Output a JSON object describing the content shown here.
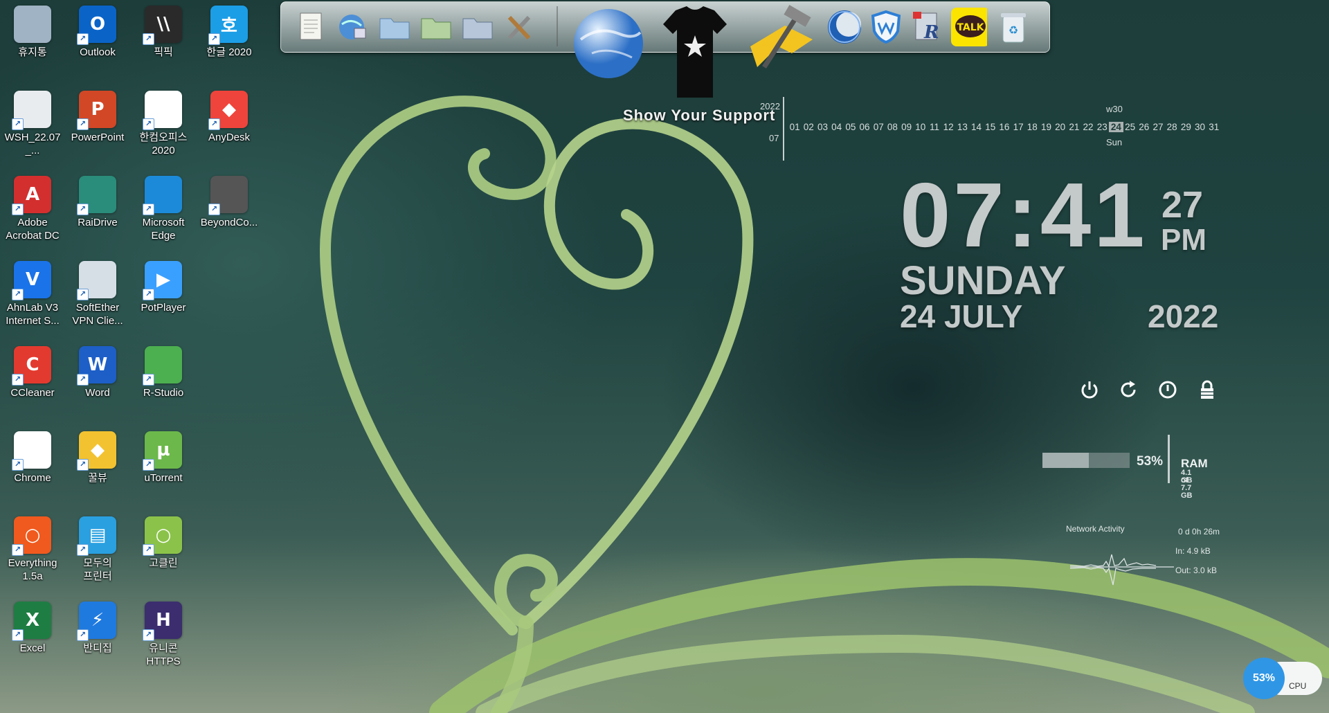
{
  "desktop": {
    "icons": [
      {
        "label": "휴지통",
        "icon": "recycle-bin-icon",
        "color": "#9fb3c4"
      },
      {
        "label": "Outlook",
        "icon": "outlook-icon",
        "color": "#0a64c8",
        "glyph": "O"
      },
      {
        "label": "픽픽",
        "icon": "picpick-icon",
        "color": "#2a2a2a",
        "glyph": "\\\\"
      },
      {
        "label": "한글 2020",
        "icon": "hangul-icon",
        "color": "#1b9ee6",
        "glyph": "호"
      },
      {
        "label": "WSH_22.07_...",
        "icon": "disc-image-icon",
        "color": "#e9ecef"
      },
      {
        "label": "PowerPoint",
        "icon": "powerpoint-icon",
        "color": "#d24726",
        "glyph": "P"
      },
      {
        "label": "한컴오피스\n2020",
        "icon": "hancom-office-icon",
        "color": "#ffffff"
      },
      {
        "label": "AnyDesk",
        "icon": "anydesk-icon",
        "color": "#ef443b",
        "glyph": "◆"
      },
      {
        "label": "Adobe\nAcrobat DC",
        "icon": "acrobat-icon",
        "color": "#d32f2f",
        "glyph": "A"
      },
      {
        "label": "RaiDrive",
        "icon": "raidrive-icon",
        "color": "#2a8c7a"
      },
      {
        "label": "Microsoft\nEdge",
        "icon": "edge-icon",
        "color": "#1c8ad8"
      },
      {
        "label": "BeyondCo...",
        "icon": "beyond-compare-icon",
        "color": "#555555"
      },
      {
        "label": "AhnLab V3\nInternet S...",
        "icon": "ahnlab-icon",
        "color": "#1a73e8",
        "glyph": "V"
      },
      {
        "label": "SoftEther\nVPN Clie...",
        "icon": "softether-icon",
        "color": "#d6dee6"
      },
      {
        "label": "PotPlayer",
        "icon": "potplayer-icon",
        "color": "#3aa0ff",
        "glyph": "▶"
      },
      {
        "label": "",
        "icon": "",
        "color": ""
      },
      {
        "label": "CCleaner",
        "icon": "ccleaner-icon",
        "color": "#e33a2f",
        "glyph": "C"
      },
      {
        "label": "Word",
        "icon": "word-icon",
        "color": "#1d5fc7",
        "glyph": "W"
      },
      {
        "label": "R-Studio",
        "icon": "r-studio-icon",
        "color": "#4caf50"
      },
      {
        "label": "",
        "icon": "",
        "color": ""
      },
      {
        "label": "Chrome",
        "icon": "chrome-icon",
        "color": "#ffffff"
      },
      {
        "label": "꿀뷰",
        "icon": "honeyview-icon",
        "color": "#f2c230",
        "glyph": "◆"
      },
      {
        "label": "uTorrent",
        "icon": "utorrent-icon",
        "color": "#6cb84a",
        "glyph": "µ"
      },
      {
        "label": "",
        "icon": "",
        "color": ""
      },
      {
        "label": "Everything\n1.5a",
        "icon": "everything-icon",
        "color": "#f05a1e",
        "glyph": "○"
      },
      {
        "label": "모두의\n프린터",
        "icon": "printer-icon",
        "color": "#2aa0e0",
        "glyph": "▤"
      },
      {
        "label": "고클린",
        "icon": "goclean-icon",
        "color": "#8bc34a",
        "glyph": "○"
      },
      {
        "label": "",
        "icon": "",
        "color": ""
      },
      {
        "label": "Excel",
        "icon": "excel-icon",
        "color": "#1e7d43",
        "glyph": "X"
      },
      {
        "label": "반디집",
        "icon": "bandizip-icon",
        "color": "#1f7ae0",
        "glyph": "⚡"
      },
      {
        "label": "유니콘\nHTTPS",
        "icon": "unicorn-https-icon",
        "color": "#3b2d6e",
        "glyph": "H"
      }
    ]
  },
  "dock": {
    "items": [
      {
        "name": "dock-notepad",
        "icon": "notepad-icon"
      },
      {
        "name": "dock-network",
        "icon": "network-globe-icon"
      },
      {
        "name": "dock-folder-1",
        "icon": "folder-icon"
      },
      {
        "name": "dock-folder-2",
        "icon": "folder-icon"
      },
      {
        "name": "dock-folder-3",
        "icon": "folder-icon"
      },
      {
        "name": "dock-tools",
        "icon": "tools-icon"
      },
      {
        "name": "dock-browser-globe",
        "icon": "globe-icon"
      },
      {
        "name": "dock-support-shirt",
        "icon": "tshirt-icon"
      },
      {
        "name": "dock-hammer",
        "icon": "hammer-icon"
      },
      {
        "name": "dock-moon",
        "icon": "moon-icon"
      },
      {
        "name": "dock-shield",
        "icon": "shield-icon"
      },
      {
        "name": "dock-r",
        "icon": "r-letter-icon"
      },
      {
        "name": "dock-kakaotalk",
        "icon": "kakaotalk-icon",
        "label": "TALK"
      },
      {
        "name": "dock-recycle",
        "icon": "recycle-bin-icon"
      }
    ],
    "support_text": "Show Your Support"
  },
  "calendar": {
    "year": "2022",
    "month": "07",
    "week": "w30",
    "day_of_week": "Sun",
    "days": [
      "01",
      "02",
      "03",
      "04",
      "05",
      "06",
      "07",
      "08",
      "09",
      "10",
      "11",
      "12",
      "13",
      "14",
      "15",
      "16",
      "17",
      "18",
      "19",
      "20",
      "21",
      "22",
      "23",
      "24",
      "25",
      "26",
      "27",
      "28",
      "29",
      "30",
      "31"
    ],
    "today": "24"
  },
  "clock": {
    "hours_minutes": "07:41",
    "seconds": "27",
    "ampm": "PM",
    "weekday": "SUNDAY",
    "date": "24 JULY",
    "year": "2022"
  },
  "power": {
    "buttons": [
      {
        "name": "shutdown-button",
        "icon": "power-icon"
      },
      {
        "name": "restart-button",
        "icon": "restart-icon"
      },
      {
        "name": "logoff-button",
        "icon": "logoff-icon"
      },
      {
        "name": "lock-button",
        "icon": "lock-icon"
      }
    ]
  },
  "ram": {
    "percent": 53,
    "percent_label": "53%",
    "label": "RAM",
    "used": "4.1 GB",
    "total": "of 7.7 GB"
  },
  "network": {
    "title": "Network Activity",
    "uptime": "0 d 0h 26m",
    "in": "In: 4.9 kB",
    "out": "Out: 3.0 kB"
  },
  "cpu": {
    "percent_label": "53%",
    "label": "CPU"
  }
}
